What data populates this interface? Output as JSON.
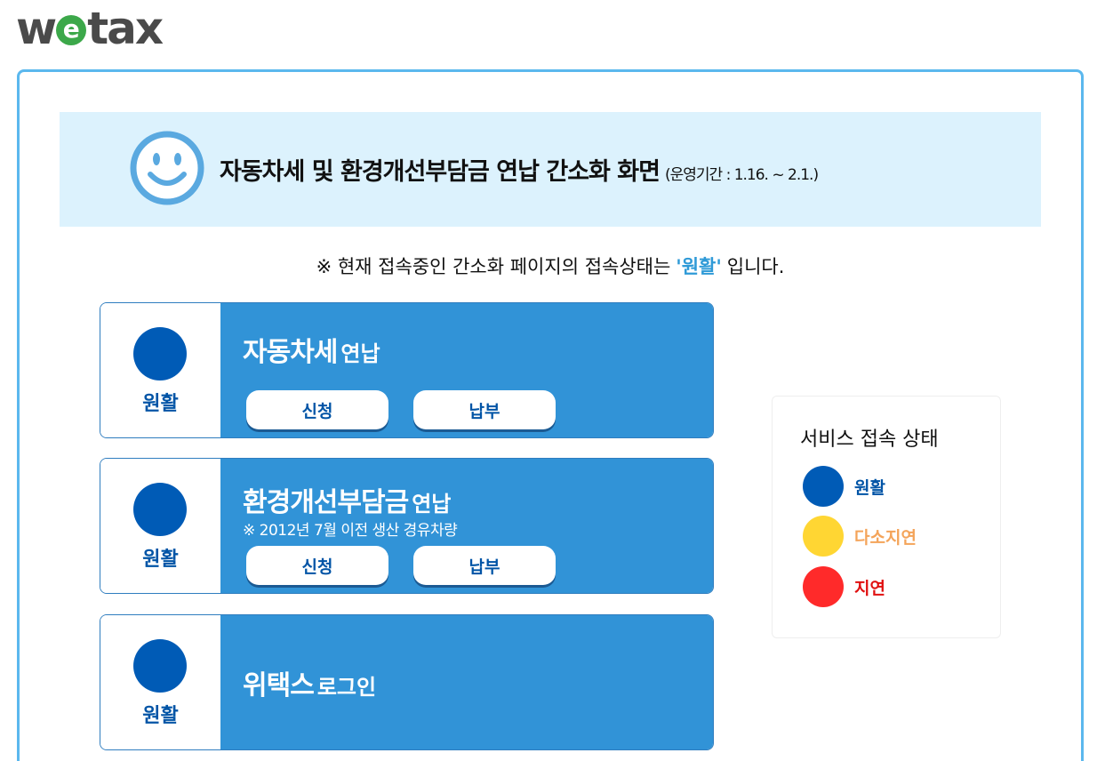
{
  "logo": {
    "prefix": "w",
    "mid": "e",
    "suffix": "tax"
  },
  "banner": {
    "title": "자동차세 및 환경개선부담금 연납 간소화 화면",
    "period": "(운영기간 : 1.16. ~ 2.1.)"
  },
  "notice": {
    "prefix": "※ 현재 접속중인 간소화 페이지의 접속상태는",
    "status": "'원활'",
    "suffix": "입니다."
  },
  "cards": [
    {
      "status": "원활",
      "title_big": "자동차세",
      "title_small": "연납",
      "subnote": "",
      "apply_label": "신청",
      "pay_label": "납부"
    },
    {
      "status": "원활",
      "title_big": "환경개선부담금",
      "title_small": "연납",
      "subnote": "※ 2012년 7월 이전 생산 경유차량",
      "apply_label": "신청",
      "pay_label": "납부"
    },
    {
      "status": "원활",
      "title_big": "위택스",
      "title_small": "로그인"
    }
  ],
  "legend": {
    "title": "서비스 접속 상태",
    "items": [
      {
        "label": "원활",
        "color": "#005bb6",
        "text_color": "#0054a6"
      },
      {
        "label": "다소지연",
        "color": "#ffd633",
        "text_color": "#f4a45a"
      },
      {
        "label": "지연",
        "color": "#ff2a2a",
        "text_color": "#e01010"
      }
    ]
  },
  "colors": {
    "accent": "#3193d7",
    "frame": "#5bb8ee",
    "banner_bg": "#dcf2fd",
    "status_ok": "#005bb6"
  }
}
